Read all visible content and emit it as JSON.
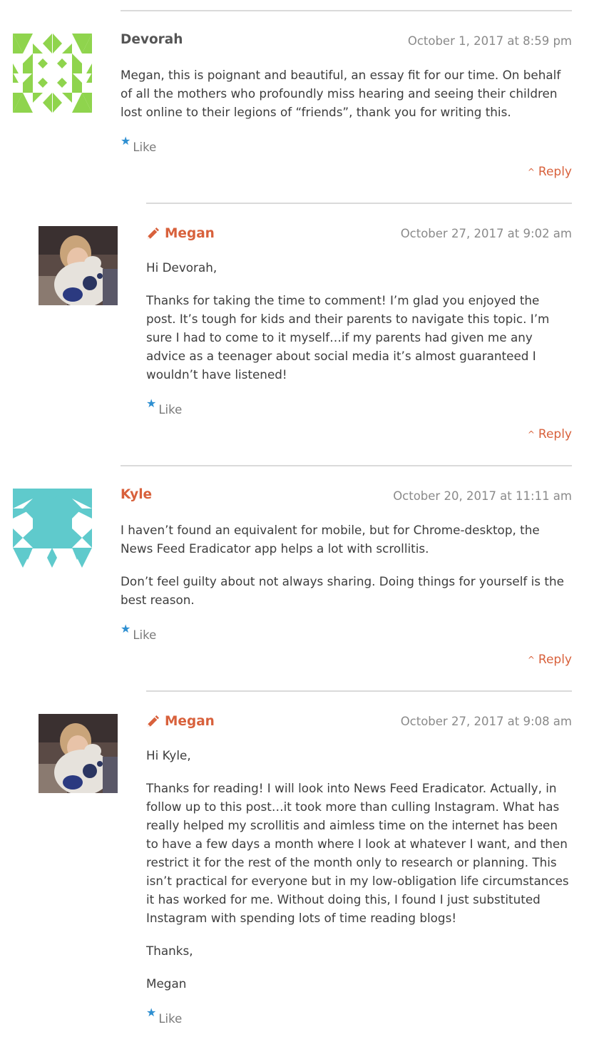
{
  "colors": {
    "accent": "#d8613c",
    "meta_text": "#8a8a8a",
    "divider": "#dadada",
    "like_star": "#2e8fd1",
    "identicon_green": "#8fd44d",
    "identicon_teal": "#5fcacc"
  },
  "comments": [
    {
      "author": "Devorah",
      "author_is_site_owner": false,
      "avatar_icon": "identicon-green",
      "date": "October 1, 2017 at 8:59 pm",
      "paragraphs": [
        "Megan, this is poignant and beautiful, an essay fit for our time. On behalf of all the mothers who profoundly miss hearing and seeing their children lost online to their legions of “friends”, thank you for writing this."
      ],
      "like_label": "Like",
      "reply_label": "Reply"
    },
    {
      "author": "Megan",
      "author_is_site_owner": true,
      "author_icon": "pencil-icon",
      "avatar_icon": "photo-avatar",
      "date": "October 27, 2017 at 9:02 am",
      "paragraphs": [
        "Hi Devorah,",
        "Thanks for taking the time to comment! I’m glad you enjoyed the post. It’s tough for kids and their parents to navigate this topic. I’m sure I had to come to it myself…if my parents had given me any advice as a teenager about social media it’s almost guaranteed I wouldn’t have listened!"
      ],
      "like_label": "Like",
      "reply_label": "Reply"
    },
    {
      "author": "Kyle",
      "author_is_site_owner": false,
      "avatar_icon": "identicon-teal",
      "date": "October 20, 2017 at 11:11 am",
      "paragraphs": [
        "I haven’t found an equivalent for mobile, but for Chrome-desktop, the News Feed Eradicator app helps a lot with scrollitis.",
        "Don’t feel guilty about not always sharing. Doing things for yourself is the best reason."
      ],
      "like_label": "Like",
      "reply_label": "Reply"
    },
    {
      "author": "Megan",
      "author_is_site_owner": true,
      "author_icon": "pencil-icon",
      "avatar_icon": "photo-avatar",
      "date": "October 27, 2017 at 9:08 am",
      "paragraphs": [
        "Hi Kyle,",
        "Thanks for reading! I will look into News Feed Eradicator. Actually, in follow up to this post…it took more than culling Instagram. What has really helped my scrollitis and aimless time on the internet has been to have a few days a month where I look at whatever I want, and then restrict it for the rest of the month only to research or planning. This isn’t practical for everyone but in my low-obligation life circumstances it has worked for me. Without doing this, I found I just substituted Instagram with spending lots of time reading blogs!",
        "Thanks,",
        "Megan"
      ],
      "like_label": "Like"
    }
  ]
}
